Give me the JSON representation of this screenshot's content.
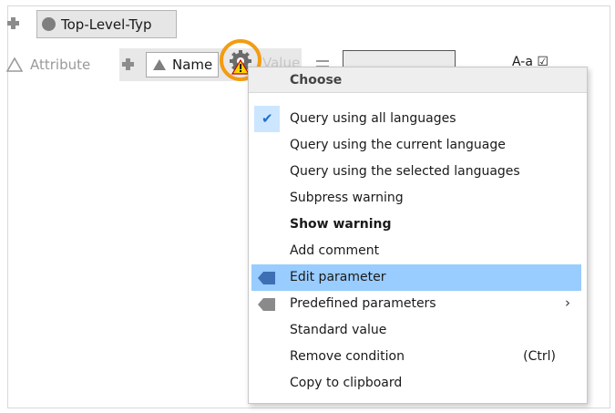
{
  "toolbar": {
    "toplevel_label": "Top-Level-Typ"
  },
  "condition_row": {
    "attribute_label": "Attribute",
    "name_label": "Name",
    "value_placeholder": "Value",
    "case_label": "A-a ☑"
  },
  "menu": {
    "header": "Choose",
    "items": [
      {
        "label": "Query using all languages",
        "checked": true
      },
      {
        "label": "Query using the current language"
      },
      {
        "label": "Query using the selected languages"
      },
      {
        "label": "Subpress warning"
      },
      {
        "label": "Show warning",
        "bold": true
      },
      {
        "label": "Add comment"
      },
      {
        "label": "Edit parameter",
        "selected": true,
        "icon": "tag-icon-blue"
      },
      {
        "label": "Predefined parameters",
        "submenu": "›",
        "icon": "tag-icon-gray"
      },
      {
        "label": "Standard value"
      },
      {
        "label": "Remove condition",
        "shortcut": "(Ctrl)"
      },
      {
        "label": "Copy to clipboard"
      }
    ]
  },
  "colors": {
    "highlight_ring": "#f39c12",
    "selected_row": "#99ccff",
    "check_color": "#1e6fd0"
  }
}
